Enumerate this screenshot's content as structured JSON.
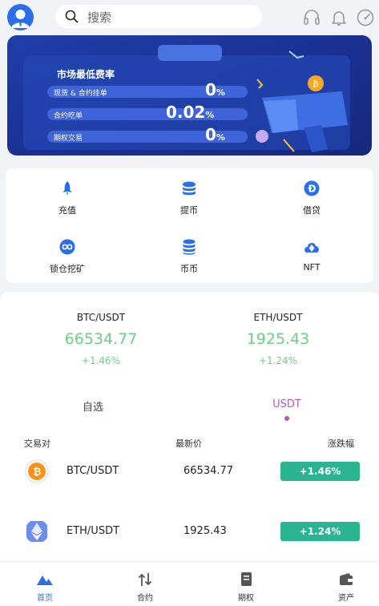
{
  "header": {
    "search_placeholder": "搜索",
    "icons": [
      "headset-icon",
      "bell-icon",
      "speedometer-icon"
    ]
  },
  "banner": {
    "title": "市场最低费率",
    "rows": [
      {
        "label": "现货 & 合约挂单",
        "value": "0",
        "unit": "%"
      },
      {
        "label": "合约吃单",
        "value": "0.02",
        "unit": "%"
      },
      {
        "label": "期权交易",
        "value": "0",
        "unit": "%"
      }
    ]
  },
  "menu": {
    "items": [
      {
        "label": "充值",
        "icon": "rocket-icon"
      },
      {
        "label": "提币",
        "icon": "coin-stack-icon"
      },
      {
        "label": "借贷",
        "icon": "dogecoin-icon"
      },
      {
        "label": "锁仓挖矿",
        "icon": "infinity-coin-icon"
      },
      {
        "label": "币币",
        "icon": "database-icon"
      },
      {
        "label": "NFT",
        "icon": "cloud-diamond-icon"
      }
    ]
  },
  "tickers": [
    {
      "pair": "BTC/USDT",
      "price": "66534.77",
      "change": "+1.46%"
    },
    {
      "pair": "ETH/USDT",
      "price": "1925.43",
      "change": "+1.24%"
    }
  ],
  "tabs": {
    "favorites": "自选",
    "usdt": "USDT",
    "active": "usdt"
  },
  "table": {
    "headers": {
      "pair": "交易对",
      "price": "最新价",
      "change": "涨跌幅"
    },
    "rows": [
      {
        "pair": "BTC/USDT",
        "price": "66534.77",
        "change": "+1.46%",
        "icon": "bitcoin-icon"
      },
      {
        "pair": "ETH/USDT",
        "price": "1925.43",
        "change": "+1.24%",
        "icon": "ethereum-icon"
      }
    ]
  },
  "bottom_nav": [
    {
      "label": "首页",
      "icon": "home-mountain-icon",
      "active": true
    },
    {
      "label": "合约",
      "icon": "arrows-updown-icon",
      "active": false
    },
    {
      "label": "期权",
      "icon": "document-icon",
      "active": false
    },
    {
      "label": "资产",
      "icon": "wallet-icon",
      "active": false
    }
  ],
  "colors": {
    "accent": "#2b6fe8",
    "up": "#6fce86",
    "badge": "#2bb491",
    "tab_active": "#b455c7"
  }
}
